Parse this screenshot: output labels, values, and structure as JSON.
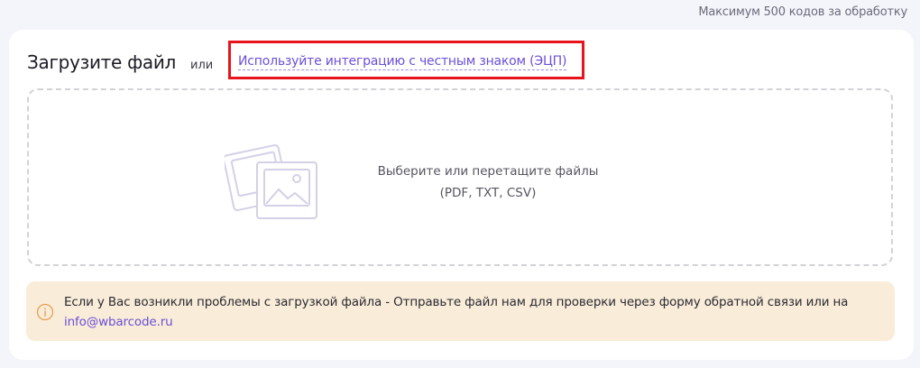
{
  "header": {
    "limit_note": "Максимум 500 кодов за обработку"
  },
  "upload": {
    "title": "Загрузите файл",
    "or_label": "или",
    "esign_link": "Используйте интеграцию с честным знаком (ЭЦП)"
  },
  "dropzone": {
    "line1": "Выберите или перетащите файлы",
    "line2": "(PDF, TXT, CSV)",
    "icon": "images-icon"
  },
  "notice": {
    "icon": "info-icon",
    "text_before": "Если у Вас возникли проблемы с загрузкой файла - Отправьте файл нам для проверки через форму обратной связи или на ",
    "email": "info@wbarcode.ru"
  },
  "colors": {
    "accent": "#6b4fd8",
    "highlight": "#e8141c",
    "notice_bg": "#f9ecd8",
    "page_bg": "#f4f5fb"
  }
}
